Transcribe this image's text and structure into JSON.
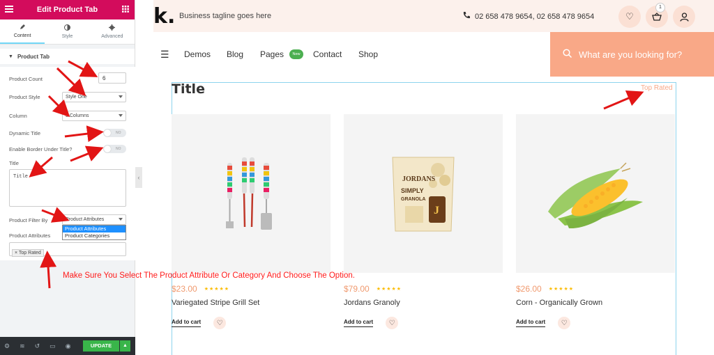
{
  "editor": {
    "title": "Edit Product Tab",
    "tabs": [
      {
        "label": "Content",
        "icon": "pencil-icon"
      },
      {
        "label": "Style",
        "icon": "contrast-icon"
      },
      {
        "label": "Advanced",
        "icon": "gear-icon"
      }
    ],
    "section": "Product Tab",
    "fields": {
      "count_label": "Product Count",
      "count_value": "6",
      "style_label": "Product Style",
      "style_value": "Style One",
      "column_label": "Column",
      "column_value": "3 Columns",
      "dynamic_label": "Dynamic Title",
      "dynamic_toggle": "NO",
      "border_label": "Enable Border Under Title?",
      "border_toggle": "NO",
      "title_label": "Title",
      "title_value": "Title",
      "filter_label": "Product Filter By",
      "filter_value": "Product Attributes",
      "filter_options": [
        "Product Attributes",
        "Product Categories"
      ],
      "attrs_label": "Product Attributes",
      "attrs_tag": "× Top Rated"
    },
    "footer": {
      "update_label": "UPDATE"
    }
  },
  "site": {
    "logo": "k.",
    "tagline": "Business tagline goes here",
    "phone": "02 658 478 9654, 02 658 478 9654",
    "cart_count": "1",
    "nav": [
      "Demos",
      "Blog",
      "Pages",
      "Contact",
      "Shop"
    ],
    "new_badge": "New",
    "search_placeholder": "What are you looking for?",
    "section_title": "Title",
    "top_rated": "Top Rated",
    "products": [
      {
        "price": "$23.00",
        "name": "Variegated Stripe Grill Set",
        "add": "Add to cart",
        "stars": "★★★★★"
      },
      {
        "price": "$79.00",
        "name": "Jordans Granoly",
        "add": "Add to cart",
        "stars": "★★★★★"
      },
      {
        "price": "$26.00",
        "name": "Corn - Organically Grown",
        "add": "Add to cart",
        "stars": "★★★★★"
      }
    ],
    "granola": {
      "brand": "JORDANS",
      "line1": "SIMPLY",
      "line2": "GRANOLA"
    }
  },
  "annotation": "Make Sure You Select The Product Attribute Or Category And Choose The Option.",
  "colors": {
    "editor_header": "#d30c5c",
    "accent": "#f9a887",
    "arrow": "#e21515",
    "update": "#39b54a"
  }
}
